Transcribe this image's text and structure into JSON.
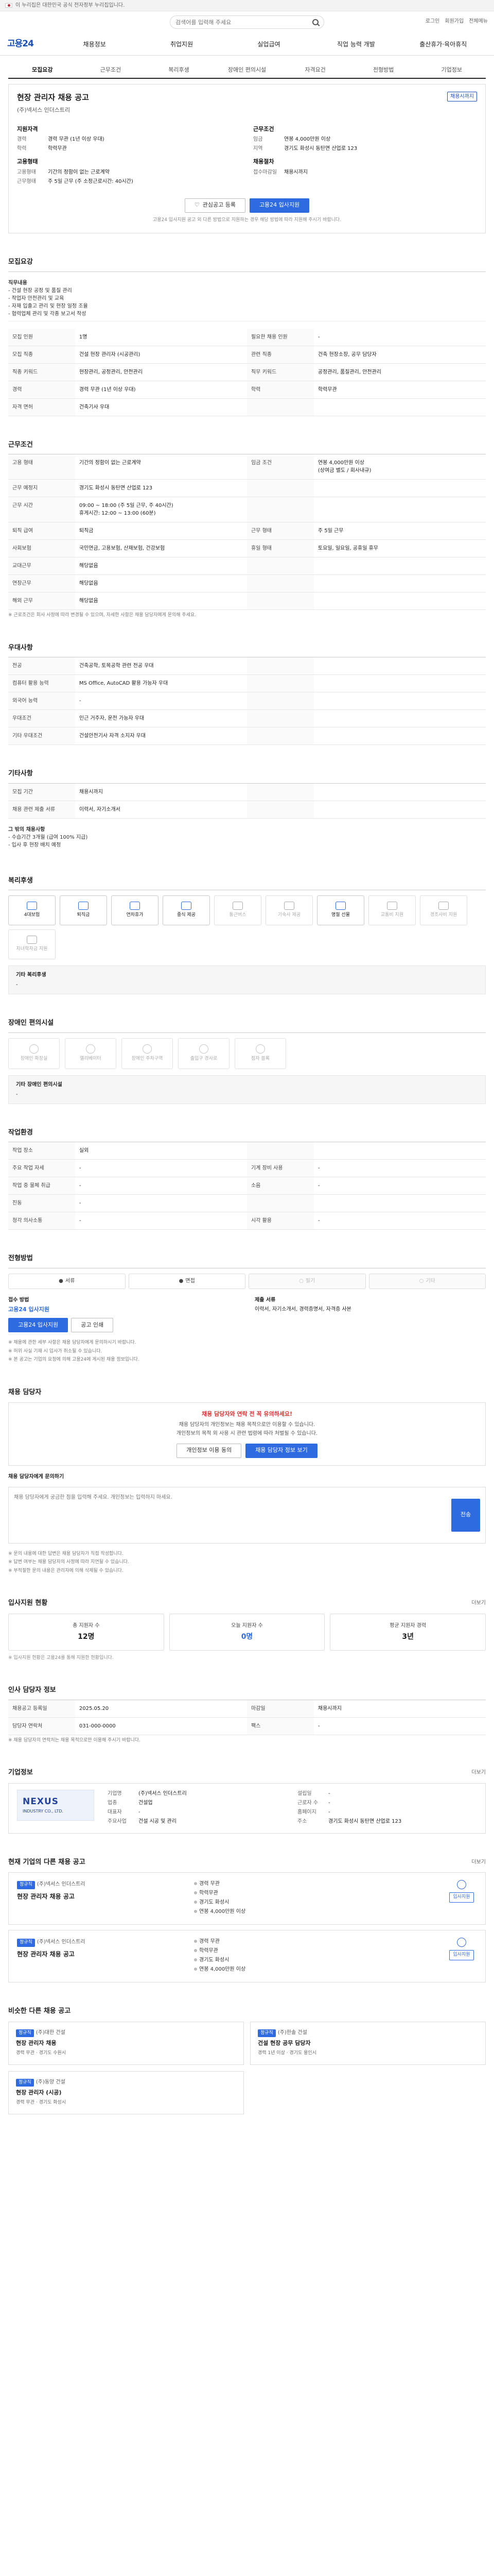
{
  "topbar": {
    "text": "이 누리집은 대한민국 공식 전자정부 누리집입니다."
  },
  "search": {
    "placeholder": "검색어를 입력해 주세요"
  },
  "util": [
    "로그인",
    "회원가입",
    "전체메뉴"
  ],
  "logo": "고용24",
  "gnb": [
    "채용정보",
    "취업지원",
    "실업급여",
    "직업 능력 개발",
    "출산휴가·육아휴직"
  ],
  "tabs": [
    "모집요강",
    "근무조건",
    "복리후생",
    "장애인 편의시설",
    "자격요건",
    "전형방법",
    "기업정보"
  ],
  "summary": {
    "title": "현장 관리자 채용 공고",
    "mark": "채용시까지",
    "company": "(주)넥서스 인더스트리",
    "recruit_title": "지원자격",
    "recruit": [
      {
        "k": "경력",
        "v": "경력 무관 (1년 이상 우대)"
      },
      {
        "k": "학력",
        "v": "학력무관"
      }
    ],
    "cond_title": "근무조건",
    "cond": [
      {
        "k": "임금",
        "v": "연봉 4,000만원 이상"
      },
      {
        "k": "지역",
        "v": "경기도 화성시 동탄면 산업로 123"
      }
    ],
    "emp_title": "고용형태",
    "emp": [
      {
        "k": "고용형태",
        "v": "기간의 정함이 없는 근로계약"
      },
      {
        "k": "근무형태",
        "v": "주 5일 근무 (주 소정근로시간: 40시간)"
      }
    ],
    "period_title": "채용절차",
    "period": [
      {
        "k": "접수마감일",
        "v": "채용시까지"
      }
    ],
    "btn_scrap": "관심공고 등록",
    "btn_apply": "고용24 입사지원",
    "notice": "고용24 입사지원 공고 외 다른 방법으로 지원하는 경우 해당 방법에 따라 지원해 주시기 바랍니다."
  },
  "s_recruit": {
    "title": "모집요강",
    "content_title": "직무내용",
    "content": "- 건설 현장 공정 및 품질 관리\n- 작업자 안전관리 및 교육\n- 자재 입출고 관리 및 현장 일정 조율\n- 협력업체 관리 및 각종 보고서 작성",
    "rows": [
      [
        {
          "k": "모집 인원",
          "v": "1명"
        },
        {
          "k": "필요한 채용 인원",
          "v": "-"
        }
      ],
      [
        {
          "k": "모집 직종",
          "v": "건설 현장 관리자 (시공관리)"
        },
        {
          "k": "관련 직종",
          "v": "건축 현장소장, 공무 담당자"
        }
      ],
      [
        {
          "k": "직종 키워드",
          "v": "현장관리, 공정관리, 안전관리"
        },
        {
          "k": "직무 키워드",
          "v": "공정관리, 품질관리, 안전관리"
        }
      ],
      [
        {
          "k": "경력",
          "v": "경력 무관 (1년 이상 우대)"
        },
        {
          "k": "학력",
          "v": "학력무관"
        }
      ],
      [
        {
          "k": "자격 면허",
          "v": "건축기사 우대"
        },
        {
          "k": "",
          "v": ""
        }
      ]
    ]
  },
  "s_work": {
    "title": "근무조건",
    "rows": [
      [
        {
          "k": "고용 형태",
          "v": "기간의 정함이 없는 근로계약"
        },
        {
          "k": "임금 조건",
          "v": "연봉 4,000만원 이상\n(상여금 별도 / 회사내규)"
        }
      ],
      [
        {
          "k": "근무 예정지",
          "v": "경기도 화성시 동탄면 산업로 123"
        },
        {
          "k": "",
          "v": ""
        }
      ],
      [
        {
          "k": "근무 시간",
          "v": "09:00 ~ 18:00 (주 5일 근무, 주 40시간)\n휴게시간: 12:00 ~ 13:00 (60분)"
        },
        {
          "k": "",
          "v": ""
        }
      ],
      [
        {
          "k": "퇴직 급여",
          "v": "퇴직금"
        },
        {
          "k": "근무 형태",
          "v": "주 5일 근무"
        }
      ],
      [
        {
          "k": "사회보험",
          "v": "국민연금, 고용보험, 산재보험, 건강보험"
        },
        {
          "k": "휴일 형태",
          "v": "토요일, 일요일, 공휴일 휴무"
        }
      ],
      [
        {
          "k": "교대근무",
          "v": "해당없음"
        },
        {
          "k": "",
          "v": ""
        }
      ],
      [
        {
          "k": "연장근무",
          "v": "해당없음"
        },
        {
          "k": "",
          "v": ""
        }
      ],
      [
        {
          "k": "해외 근무",
          "v": "해당없음"
        },
        {
          "k": "",
          "v": ""
        }
      ]
    ],
    "note": "※ 근로조건은 회사 사정에 따라 변경될 수 있으며, 자세한 사항은 채용 담당자에게 문의해 주세요."
  },
  "s_etc": {
    "title": "우대사항",
    "rows": [
      [
        {
          "k": "전공",
          "v": "건축공학, 토목공학 관련 전공 우대"
        },
        {
          "k": "",
          "v": ""
        }
      ],
      [
        {
          "k": "컴퓨터 활용 능력",
          "v": "MS Office, AutoCAD 활용 가능자 우대"
        },
        {
          "k": "",
          "v": ""
        }
      ],
      [
        {
          "k": "외국어 능력",
          "v": "-"
        },
        {
          "k": "",
          "v": ""
        }
      ],
      [
        {
          "k": "우대조건",
          "v": "인근 거주자, 운전 가능자 우대"
        },
        {
          "k": "",
          "v": ""
        }
      ],
      [
        {
          "k": "기타 우대조건",
          "v": "건설안전기사 자격 소지자 우대"
        },
        {
          "k": "",
          "v": ""
        }
      ]
    ]
  },
  "s_cond": {
    "title": "기타사항",
    "rows": [
      [
        {
          "k": "모집 기간",
          "v": "채용시까지"
        },
        {
          "k": "",
          "v": ""
        }
      ],
      [
        {
          "k": "채용 관련 제출 서류",
          "v": "이력서, 자기소개서"
        },
        {
          "k": "",
          "v": ""
        }
      ]
    ],
    "extra_title": "그 밖의 채용사항",
    "extra": "- 수습기간 3개월 (급여 100% 지급)\n- 입사 후 현장 배치 예정"
  },
  "s_benefit": {
    "title": "복리후생",
    "items": [
      {
        "label": "4대보험",
        "on": true
      },
      {
        "label": "퇴직금",
        "on": true
      },
      {
        "label": "연차휴가",
        "on": true
      },
      {
        "label": "중식 제공",
        "on": true
      },
      {
        "label": "통근버스",
        "on": false
      },
      {
        "label": "기숙사 제공",
        "on": false
      },
      {
        "label": "명절 선물",
        "on": true
      },
      {
        "label": "교통비 지원",
        "on": false
      },
      {
        "label": "경조사비 지원",
        "on": false
      },
      {
        "label": "자녀학자금 지원",
        "on": false
      }
    ],
    "panel_title": "기타 복리후생",
    "panel_text": "-"
  },
  "s_facility": {
    "title": "장애인 편의시설",
    "items": [
      "장애인 화장실",
      "엘리베이터",
      "장애인 주차구역",
      "출입구 경사로",
      "점자 블록"
    ],
    "panel_title": "기타 장애인 편의시설",
    "panel_text": "-"
  },
  "s_env": {
    "title": "작업환경",
    "rows": [
      [
        {
          "k": "작업 장소",
          "v": "실외"
        },
        {
          "k": "",
          "v": ""
        }
      ],
      [
        {
          "k": "주요 작업 자세",
          "v": "-"
        },
        {
          "k": "기계 장비 사용",
          "v": "-"
        }
      ],
      [
        {
          "k": "작업 중 물체 취급",
          "v": "-"
        },
        {
          "k": "소음",
          "v": "-"
        }
      ],
      [
        {
          "k": "진동",
          "v": "-"
        },
        {
          "k": "",
          "v": ""
        }
      ],
      [
        {
          "k": "청각 의사소통",
          "v": "-"
        },
        {
          "k": "시각 활용",
          "v": "-"
        }
      ]
    ]
  },
  "s_apply": {
    "title": "전형방법",
    "steps": [
      {
        "label": "서류",
        "off": false
      },
      {
        "label": "면접",
        "off": false
      },
      {
        "label": "필기",
        "off": true
      },
      {
        "label": "기타",
        "off": true
      }
    ],
    "method_label": "접수 방법",
    "method_val": "고용24 입사지원",
    "doc_label": "제출 서류",
    "doc_val": "이력서, 자기소개서, 경력증명서, 자격증 사본",
    "btn_apply": "고용24 입사지원",
    "btn_print": "공고 인쇄",
    "notes": [
      "※ 채용에 관한 세부 사항은 채용 담당자에게 문의하시기 바랍니다.",
      "※ 허위 사실 기재 시 입사가 취소될 수 있습니다.",
      "※ 본 공고는 기업의 요청에 의해 고용24에 게시된 채용 정보입니다."
    ]
  },
  "s_manager": {
    "title": "채용 담당자",
    "warn_title": "채용 담당자와 연락 전 꼭 유의하세요!",
    "warn_lines": [
      "채용 담당자의 개인정보는 채용 목적으로만 이용할 수 있습니다.",
      "개인정보의 목적 외 사용 시 관련 법령에 따라 처벌될 수 있습니다."
    ],
    "btn_check": "개인정보 이용 동의",
    "btn_view": "채용 담당자 정보 보기",
    "inquiry_label": "채용 담당자에게 문의하기",
    "inquiry_placeholder": "채용 담당자에게 궁금한 점을 입력해 주세요. 개인정보는 입력하지 마세요.",
    "btn_send": "전송",
    "notes": [
      "※ 문의 내용에 대한 답변은 채용 담당자가 직접 작성합니다.",
      "※ 답변 여부는 채용 담당자의 사정에 따라 지연될 수 있습니다.",
      "※ 부적절한 문의 내용은 관리자에 의해 삭제될 수 있습니다."
    ]
  },
  "s_stat": {
    "title": "입사지원 현황",
    "more": "더보기",
    "cards": [
      {
        "label": "총 지원자 수",
        "val": "12명",
        "blue": false
      },
      {
        "label": "오늘 지원자 수",
        "val": "0명",
        "blue": true
      },
      {
        "label": "평균 지원자 경력",
        "val": "3년",
        "blue": false
      }
    ],
    "note": "※ 입사지원 현황은 고용24를 통해 지원한 현황입니다."
  },
  "s_hr": {
    "title": "인사 담당자 정보",
    "rows": [
      [
        {
          "k": "채용공고 등록일",
          "v": "2025.05.20"
        },
        {
          "k": "마감일",
          "v": "채용시까지"
        }
      ],
      [
        {
          "k": "담당자 연락처",
          "v": "031-000-0000"
        },
        {
          "k": "팩스",
          "v": "-"
        }
      ]
    ],
    "note": "※ 채용 담당자의 연락처는 채용 목적으로만 이용해 주시기 바랍니다."
  },
  "s_comp": {
    "title": "기업정보",
    "more": "더보기",
    "logo_big": "NEXUS",
    "logo_small": "INDUSTRY CO., LTD.",
    "rows_left": [
      {
        "k": "기업명",
        "v": "(주)넥서스 인더스트리"
      },
      {
        "k": "업종",
        "v": "건설업"
      },
      {
        "k": "대표자",
        "v": "-"
      },
      {
        "k": "주요사업",
        "v": "건설 시공 및 관리"
      }
    ],
    "rows_right": [
      {
        "k": "설립일",
        "v": "-"
      },
      {
        "k": "근로자 수",
        "v": "-"
      },
      {
        "k": "홈페이지",
        "v": "-"
      },
      {
        "k": "주소",
        "v": "경기도 화성시 동탄면 산업로 123"
      }
    ]
  },
  "s_other": {
    "title": "현재 기업의 다른 채용 공고",
    "more": "더보기",
    "jobs": [
      {
        "tag": "정규직",
        "corp": "(주)넥서스 인더스트리",
        "title": "현장 관리자 채용 공고",
        "info": [
          "경력 무관",
          "학력무관",
          "경기도 화성시",
          "연봉 4,000만원 이상"
        ],
        "apply": "입사지원"
      },
      {
        "tag": "정규직",
        "corp": "(주)넥서스 인더스트리",
        "title": "현장 관리자 채용 공고",
        "info": [
          "경력 무관",
          "학력무관",
          "경기도 화성시",
          "연봉 4,000만원 이상"
        ],
        "apply": "입사지원"
      }
    ]
  },
  "s_similar": {
    "title": "비슷한 다른 채용 공고",
    "cards": [
      {
        "tag": "정규직",
        "corp": "(주)대한 건설",
        "title": "현장 관리자 채용",
        "sub": "경력 무관 · 경기도 수원시"
      },
      {
        "tag": "정규직",
        "corp": "(주)한솔 건설",
        "title": "건설 현장 공무 담당자",
        "sub": "경력 1년 이상 · 경기도 용인시"
      },
      {
        "tag": "정규직",
        "corp": "(주)동양 건설",
        "title": "현장 관리자 (시공)",
        "sub": "경력 무관 · 경기도 화성시"
      }
    ]
  }
}
